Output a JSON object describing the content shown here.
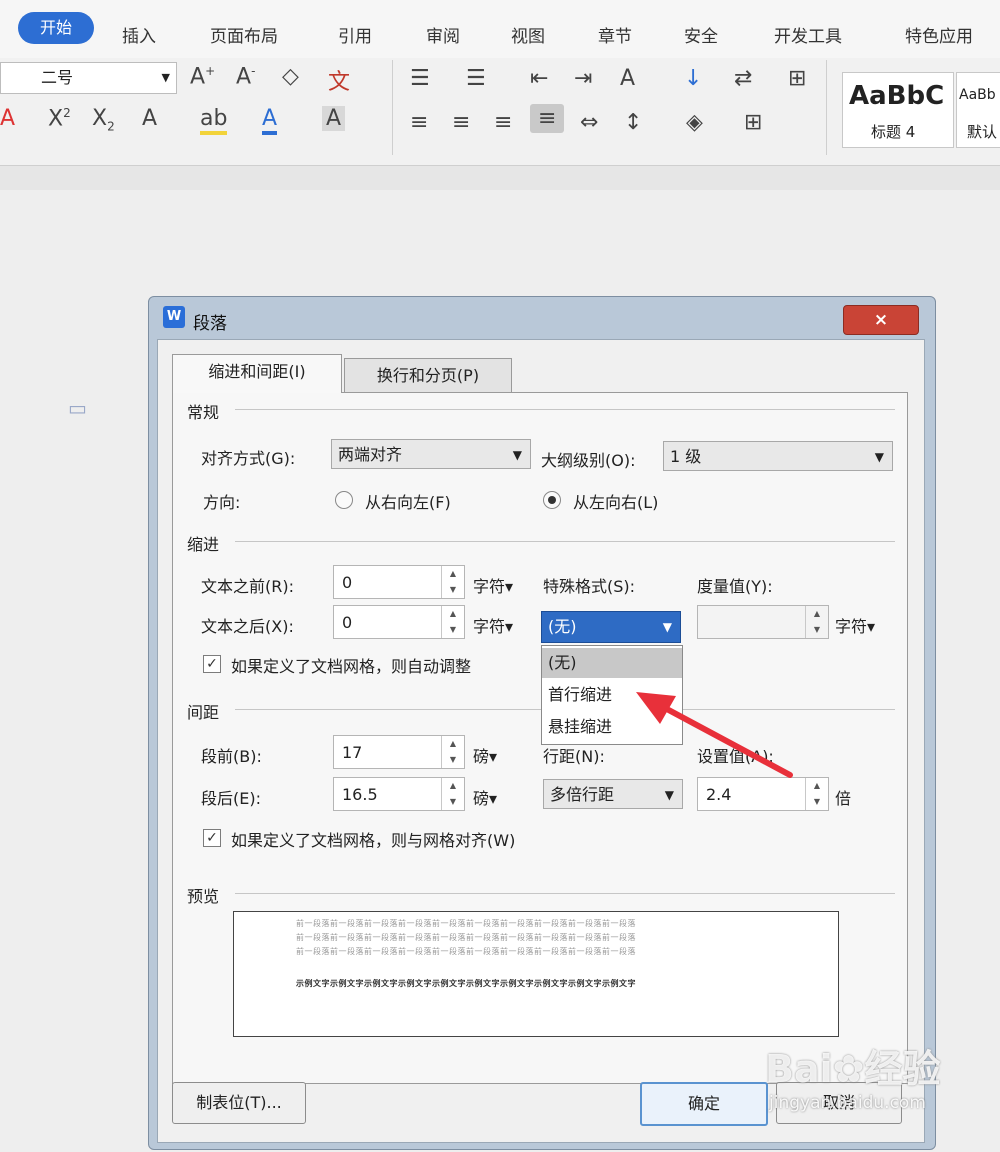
{
  "ribbon": {
    "tabs": [
      "开始",
      "插入",
      "页面布局",
      "引用",
      "审阅",
      "视图",
      "章节",
      "安全",
      "开发工具",
      "特色应用"
    ],
    "font_size": "二号",
    "styles": [
      {
        "preview": "AaBbC",
        "name": "标题 4"
      },
      {
        "preview": "AaBb",
        "name": "默认"
      }
    ]
  },
  "dialog": {
    "title": "段落",
    "close_label": "×",
    "tabs": [
      "缩进和间距(I)",
      "换行和分页(P)"
    ],
    "general": {
      "heading": "常规",
      "alignment_label": "对齐方式(G):",
      "alignment_value": "两端对齐",
      "outline_label": "大纲级别(O):",
      "outline_value": "1 级",
      "direction_label": "方向:",
      "rtl_label": "从右向左(F)",
      "ltr_label": "从左向右(L)"
    },
    "indent": {
      "heading": "缩进",
      "before_label": "文本之前(R):",
      "before_value": "0",
      "after_label": "文本之后(X):",
      "after_value": "0",
      "unit": "字符▾",
      "special_label": "特殊格式(S):",
      "special_value": "(无)",
      "measure_label": "度量值(Y):",
      "measure_value": "",
      "measure_unit": "字符▾",
      "grid_check_label": "如果定义了文档网格，则自动调整",
      "special_options": [
        "(无)",
        "首行缩进",
        "悬挂缩进"
      ]
    },
    "spacing": {
      "heading": "间距",
      "before_label": "段前(B):",
      "before_value": "17",
      "after_label": "段后(E):",
      "after_value": "16.5",
      "unit": "磅▾",
      "line_label": "行距(N):",
      "line_value": "多倍行距",
      "set_label": "设置值(A):",
      "set_value": "2.4",
      "set_unit": "倍",
      "grid_check_label": "如果定义了文档网格，则与网格对齐(W)"
    },
    "preview": {
      "heading": "预览",
      "prev_text": "前一段落前一段落前一段落前一段落前一段落前一段落前一段落前一段落前一段落前一段落",
      "sample_text": "示例文字示例文字示例文字示例文字示例文字示例文字示例文字示例文字示例文字示例文字"
    },
    "buttons": {
      "tabs": "制表位(T)...",
      "ok": "确定",
      "cancel": "取消"
    }
  },
  "watermark": {
    "brand": "Bai",
    "brand2": "经验",
    "url": "jingyan.baidu.com"
  },
  "colors": {
    "accent": "#2d6ed3",
    "close": "#c94436",
    "arrow": "#e8303a",
    "selected_item": "#c8c8c8"
  }
}
